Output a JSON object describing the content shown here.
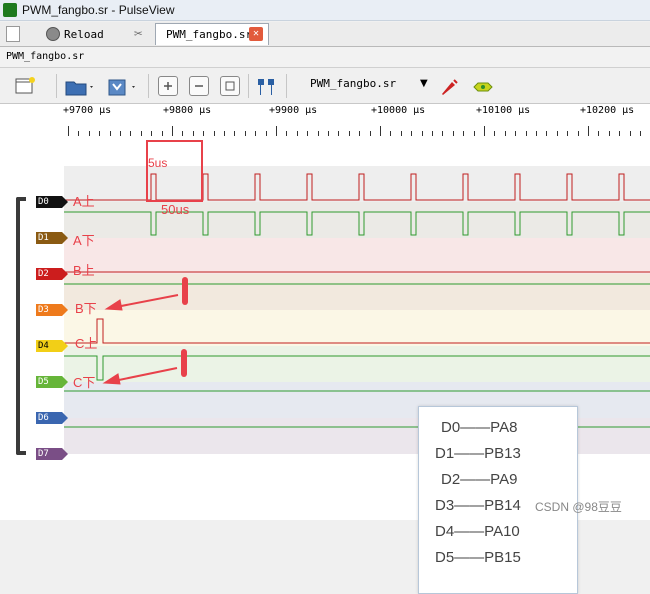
{
  "window": {
    "title": "PWM_fangbo.sr - PulseView"
  },
  "tabs": {
    "reload_label": "Reload",
    "active_tab": "PWM_fangbo.sr",
    "close_glyph": "✕"
  },
  "document_label": "PWM_fangbo.sr",
  "toolbar": {
    "device": "PWM_fangbo.sr",
    "dropdown_glyph": "▼"
  },
  "ruler": {
    "labels": [
      "+9700 μs",
      "+9800 μs",
      "+9900 μs",
      "+10000 μs",
      "+10100 μs",
      "+10200 μs"
    ]
  },
  "channels": [
    {
      "label": "D0",
      "color": "#111111"
    },
    {
      "label": "D1",
      "color": "#8a5a12"
    },
    {
      "label": "D2",
      "color": "#cc1d1d"
    },
    {
      "label": "D3",
      "color": "#ee7a1c"
    },
    {
      "label": "D4",
      "color": "#f2cf17"
    },
    {
      "label": "D5",
      "color": "#66b539"
    },
    {
      "label": "D6",
      "color": "#3a66b0"
    },
    {
      "label": "D7",
      "color": "#7a4e86"
    }
  ],
  "annotations": {
    "period": "5us",
    "pulse": "50us",
    "a_high": "A上",
    "a_low": "A下",
    "b_high": "B上",
    "b_low": "B下",
    "c_high": "C上",
    "c_low": "C下"
  },
  "legend": [
    "D0——PA8",
    "D1——PB13",
    "D2——PA9",
    "D3——PB14",
    "D4——PA10",
    "D5——PB15"
  ],
  "watermark": "CSDN @98豆豆"
}
